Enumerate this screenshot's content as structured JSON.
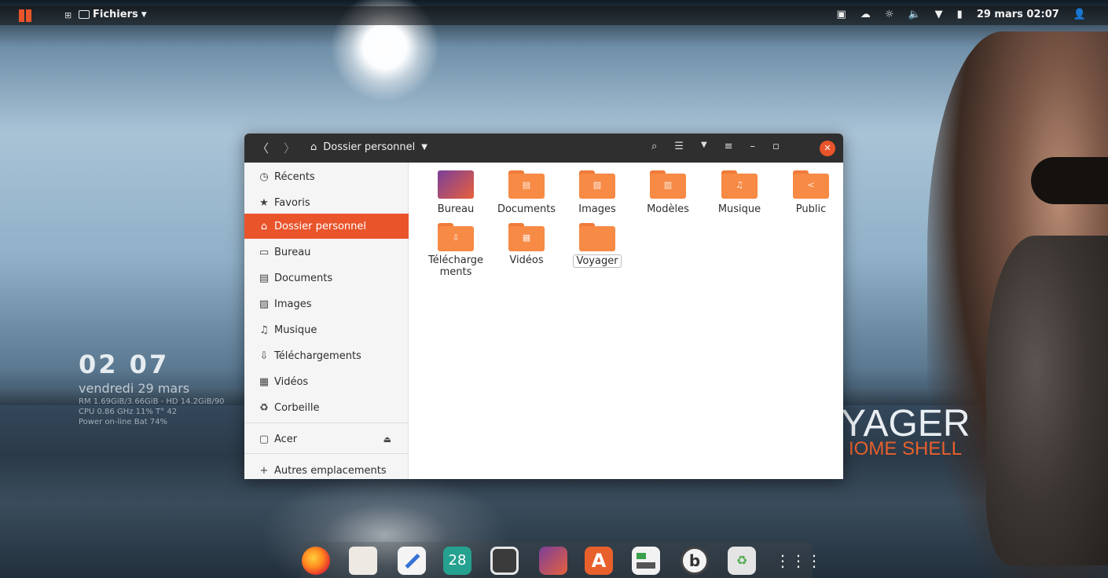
{
  "topbar": {
    "app_menu": "Fichiers",
    "clock": "29 mars 02:07"
  },
  "widget": {
    "time": "02 07",
    "date": "vendredi 29 mars",
    "line1": "RM 1.69GiB/3.66GiB - HD 14.2GiB/90",
    "line2": "CPU 0.86 GHz 11% T° 42",
    "line3": "Power on-line Bat 74%"
  },
  "wallpaper": {
    "brand": "YAGER",
    "brand_sub": "IOME SHELL"
  },
  "window": {
    "path": "Dossier personnel"
  },
  "sidebar": {
    "items": [
      {
        "label": "Récents",
        "icon": "clock-icon"
      },
      {
        "label": "Favoris",
        "icon": "star-icon"
      },
      {
        "label": "Dossier personnel",
        "icon": "home-icon"
      },
      {
        "label": "Bureau",
        "icon": "desktop-icon"
      },
      {
        "label": "Documents",
        "icon": "document-icon"
      },
      {
        "label": "Images",
        "icon": "image-icon"
      },
      {
        "label": "Musique",
        "icon": "music-icon"
      },
      {
        "label": "Téléchargements",
        "icon": "download-icon"
      },
      {
        "label": "Vidéos",
        "icon": "video-icon"
      },
      {
        "label": "Corbeille",
        "icon": "trash-icon"
      },
      {
        "label": "Acer",
        "icon": "drive-icon"
      },
      {
        "label": "Autres emplacements",
        "icon": "plus-icon"
      }
    ]
  },
  "files": [
    {
      "label": "Bureau",
      "icon": "desktop-folder-icon"
    },
    {
      "label": "Documents",
      "icon": "documents-folder-icon"
    },
    {
      "label": "Images",
      "icon": "images-folder-icon"
    },
    {
      "label": "Modèles",
      "icon": "templates-folder-icon"
    },
    {
      "label": "Musique",
      "icon": "music-folder-icon"
    },
    {
      "label": "Public",
      "icon": "public-folder-icon"
    },
    {
      "label": "Télécharge ments",
      "icon": "downloads-folder-icon"
    },
    {
      "label": "Vidéos",
      "icon": "videos-folder-icon"
    },
    {
      "label": "Voyager",
      "icon": "folder-icon"
    }
  ],
  "dock": {
    "calendar_day": "28"
  },
  "colors": {
    "accent": "#e9542b",
    "folder": "#f78a45",
    "headerbar": "#2f2f2f"
  }
}
